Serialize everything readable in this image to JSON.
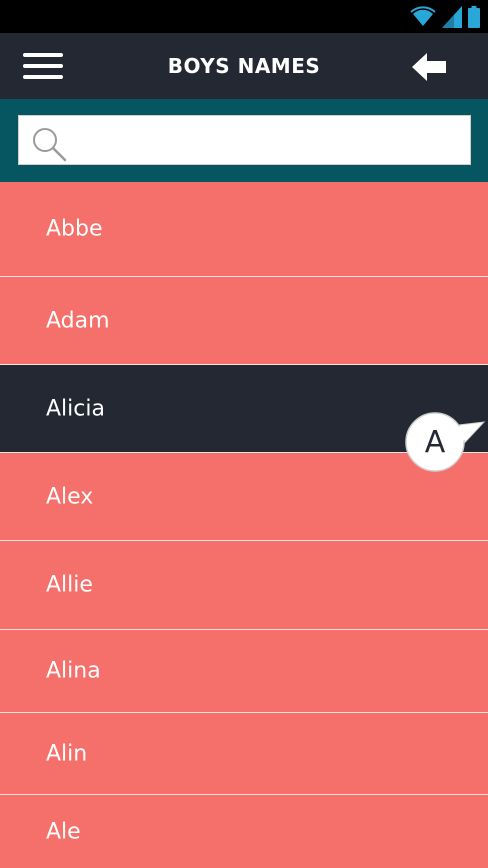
{
  "header": {
    "title": "BOYS NAMES",
    "menu_icon": "hamburger-menu-icon",
    "back_icon": "back-arrow-icon"
  },
  "status_bar": {
    "icons": [
      "wifi-icon",
      "signal-icon",
      "battery-icon"
    ],
    "accent_color": "#2aa7d9"
  },
  "search": {
    "placeholder": "",
    "value": "",
    "icon": "search-icon"
  },
  "names": [
    {
      "label": "Abbe",
      "selected": false
    },
    {
      "label": "Adam",
      "selected": false
    },
    {
      "label": "Alicia",
      "selected": true
    },
    {
      "label": "Alex",
      "selected": false
    },
    {
      "label": "Allie",
      "selected": false
    },
    {
      "label": "Alina",
      "selected": false
    },
    {
      "label": "Alin",
      "selected": false
    },
    {
      "label": "Ale",
      "selected": false
    }
  ],
  "annotation": {
    "label": "A"
  },
  "colors": {
    "list_background": "#f56f6b",
    "header_background": "#232833",
    "search_background": "#055660",
    "selected_background": "#232833"
  }
}
